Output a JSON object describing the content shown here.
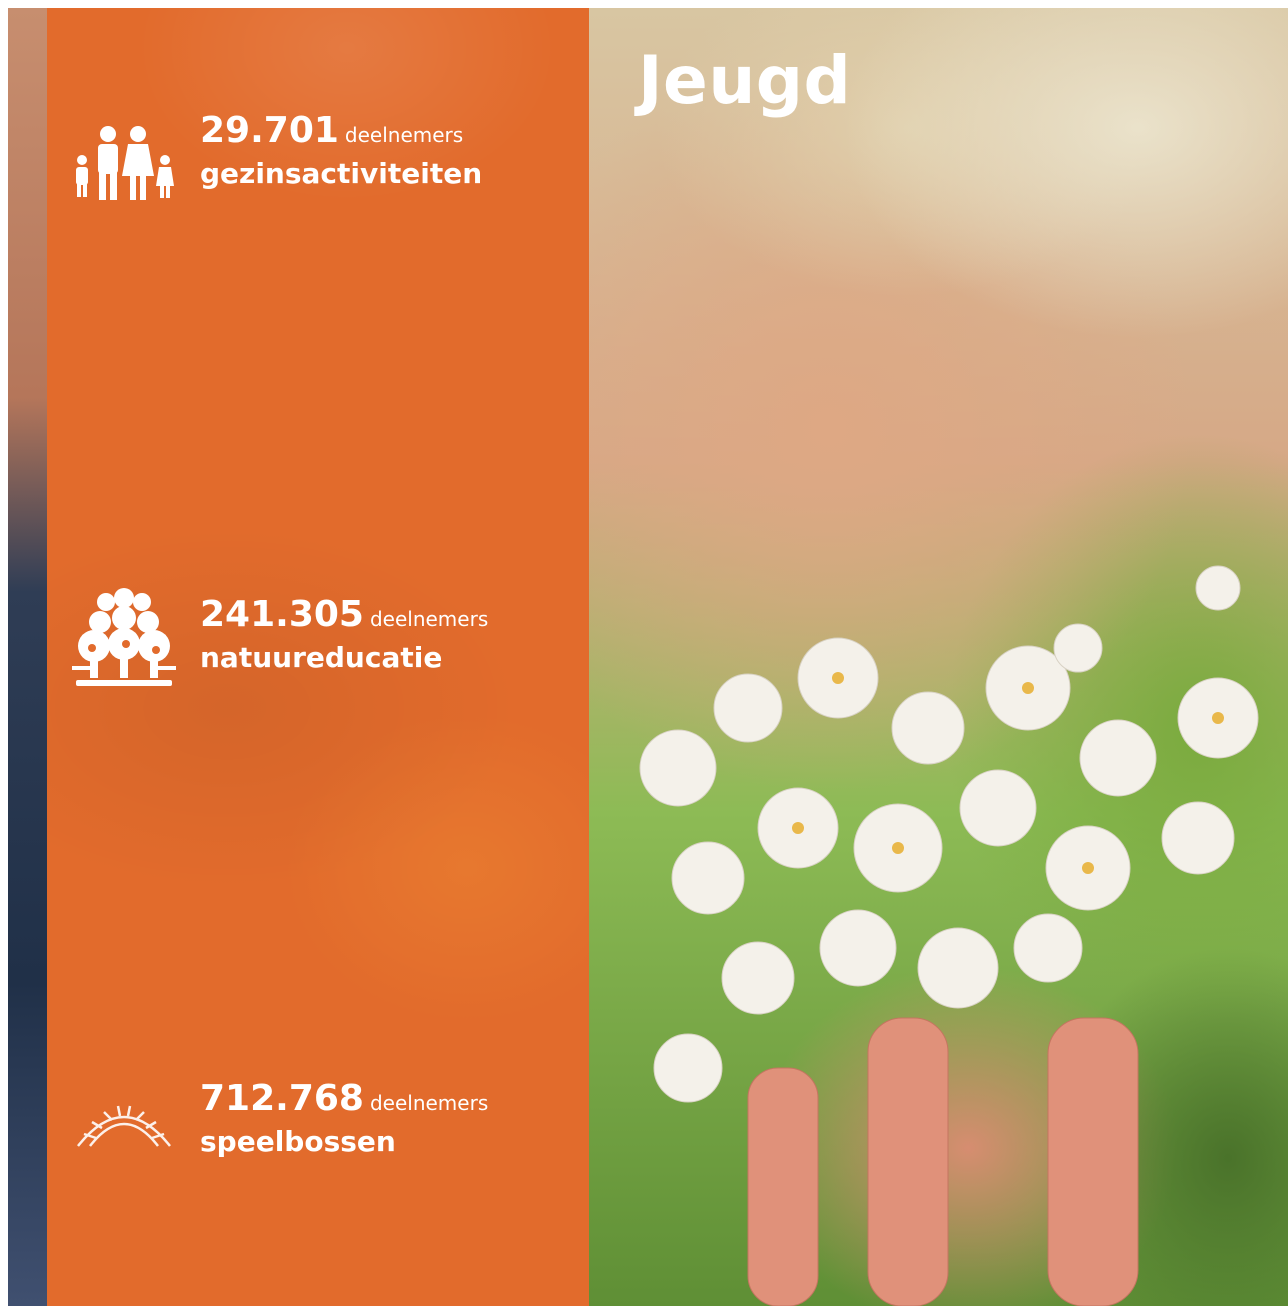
{
  "title": "Jeugd",
  "stats": [
    {
      "number": "29.701",
      "unit": "deelnemers",
      "label": "gezinsactiviteiten",
      "icon": "family-icon"
    },
    {
      "number": "241.305",
      "unit": "deelnemers",
      "label": "natuureducatie",
      "icon": "trees-icon"
    },
    {
      "number": "712.768",
      "unit": "deelnemers",
      "label": "speelbossen",
      "icon": "climbing-arch-icon"
    }
  ]
}
